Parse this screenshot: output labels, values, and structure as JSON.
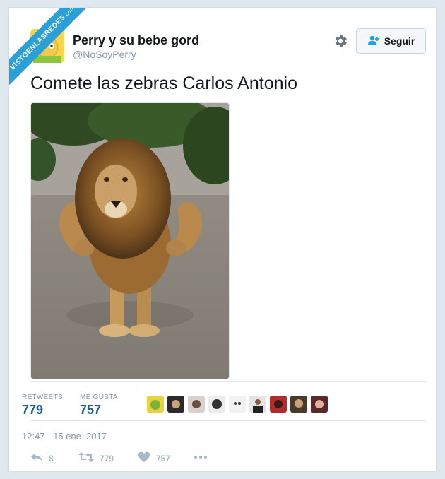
{
  "watermark": {
    "text": "VISTOENLASREDES",
    "suffix": ".com"
  },
  "tweet": {
    "author_name": "Perry y su bebe gord",
    "handle": "@NoSoyPerry",
    "follow_label": "Seguir",
    "text": "Comete las zebras Carlos Antonio",
    "date": "12:47 - 15 ene. 2017"
  },
  "stats": {
    "retweets_label": "RETWEETS",
    "retweets_value": "779",
    "likes_label": "ME GUSTA",
    "likes_value": "757"
  },
  "actions": {
    "reply_count": "8",
    "retweet_count": "779",
    "like_count": "757"
  },
  "icons": [
    "gear-icon",
    "add-user-icon",
    "reply-icon",
    "retweet-icon",
    "heart-icon",
    "more-icon"
  ],
  "colors": {
    "accent": "#1b5f93",
    "muted": "#8899a6",
    "ribbon": "#2a9fd8"
  }
}
